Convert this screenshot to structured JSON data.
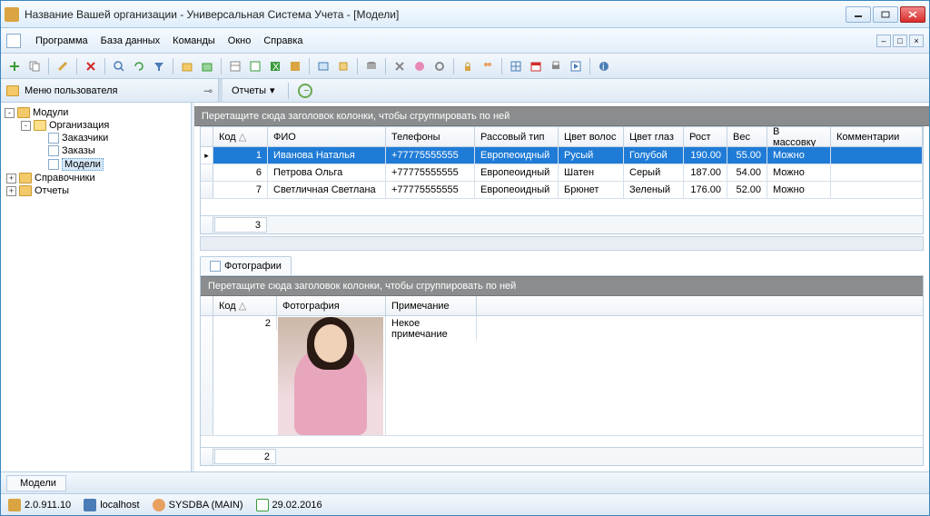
{
  "window": {
    "title": "Название Вашей организации - Универсальная Система Учета - [Модели]"
  },
  "menu": {
    "items": [
      "Программа",
      "База данных",
      "Команды",
      "Окно",
      "Справка"
    ]
  },
  "userMenu": {
    "label": "Меню пользователя"
  },
  "reports": {
    "label": "Отчеты"
  },
  "tree": {
    "root": {
      "label": "Модули",
      "exp": "-"
    },
    "org": {
      "label": "Организация",
      "exp": "-"
    },
    "customers": "Заказчики",
    "orders": "Заказы",
    "models": "Модели",
    "refs": {
      "label": "Справочники",
      "exp": "+"
    },
    "reports": {
      "label": "Отчеты",
      "exp": "+"
    }
  },
  "grid1": {
    "groupHint": "Перетащите сюда заголовок колонки, чтобы сгруппировать по ней",
    "cols": [
      "Код",
      "ФИО",
      "Телефоны",
      "Рассовый тип",
      "Цвет волос",
      "Цвет глаз",
      "Рост",
      "Вес",
      "В массовку",
      "Комментарии"
    ],
    "rows": [
      {
        "code": "1",
        "fio": "Иванова Наталья",
        "phone": "+77775555555",
        "race": "Европеоидный",
        "hair": "Русый",
        "eyes": "Голубой",
        "height": "190.00",
        "weight": "55.00",
        "mass": "Можно",
        "comment": ""
      },
      {
        "code": "6",
        "fio": "Петрова Ольга",
        "phone": "+77775555555",
        "race": "Европеоидный",
        "hair": "Шатен",
        "eyes": "Серый",
        "height": "187.00",
        "weight": "54.00",
        "mass": "Можно",
        "comment": ""
      },
      {
        "code": "7",
        "fio": "Светличная Светлана",
        "phone": "+77775555555",
        "race": "Европеоидный",
        "hair": "Брюнет",
        "eyes": "Зеленый",
        "height": "176.00",
        "weight": "52.00",
        "mass": "Можно",
        "comment": ""
      }
    ],
    "count": "3"
  },
  "tabPhotos": "Фотографии",
  "grid2": {
    "groupHint": "Перетащите сюда заголовок колонки, чтобы сгруппировать по ней",
    "cols": [
      "Код",
      "Фотография",
      "Примечание"
    ],
    "row": {
      "code": "2",
      "note": "Некое примечание"
    },
    "count": "2"
  },
  "bottomTab": "Модели",
  "status": {
    "version": "2.0.911.10",
    "host": "localhost",
    "user": "SYSDBA (MAIN)",
    "date": "29.02.2016"
  }
}
